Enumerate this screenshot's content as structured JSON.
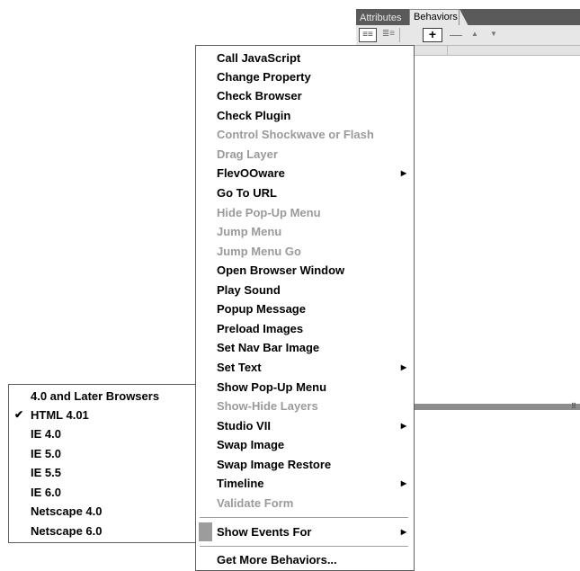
{
  "panel": {
    "tabs": [
      {
        "label": "Attributes"
      },
      {
        "label": "Behaviors"
      }
    ],
    "toolbar": {
      "show_set_icon": "≡≡",
      "show_all_icon": "≣≡",
      "add_icon": "+",
      "remove_icon": "—",
      "up_icon": "▲",
      "down_icon": "▼"
    },
    "grip_icon": "⠿"
  },
  "menu": {
    "items": [
      {
        "label": "Call JavaScript",
        "enabled": true
      },
      {
        "label": "Change Property",
        "enabled": true
      },
      {
        "label": "Check Browser",
        "enabled": true
      },
      {
        "label": "Check Plugin",
        "enabled": true
      },
      {
        "label": "Control Shockwave or Flash",
        "enabled": false
      },
      {
        "label": "Drag Layer",
        "enabled": false
      },
      {
        "label": "FlevOOware",
        "enabled": true,
        "submenu": true
      },
      {
        "label": "Go To URL",
        "enabled": true
      },
      {
        "label": "Hide Pop-Up Menu",
        "enabled": false
      },
      {
        "label": "Jump Menu",
        "enabled": false
      },
      {
        "label": "Jump Menu Go",
        "enabled": false
      },
      {
        "label": "Open Browser Window",
        "enabled": true
      },
      {
        "label": "Play Sound",
        "enabled": true
      },
      {
        "label": "Popup Message",
        "enabled": true
      },
      {
        "label": "Preload Images",
        "enabled": true
      },
      {
        "label": "Set Nav Bar Image",
        "enabled": true
      },
      {
        "label": "Set Text",
        "enabled": true,
        "submenu": true
      },
      {
        "label": "Show Pop-Up Menu",
        "enabled": true
      },
      {
        "label": "Show-Hide Layers",
        "enabled": false
      },
      {
        "label": "Studio VII",
        "enabled": true,
        "submenu": true
      },
      {
        "label": "Swap Image",
        "enabled": true
      },
      {
        "label": "Swap Image Restore",
        "enabled": true
      },
      {
        "label": "Timeline",
        "enabled": true,
        "submenu": true
      },
      {
        "label": "Validate Form",
        "enabled": false
      }
    ],
    "show_events_for": {
      "label": "Show Events For",
      "submenu": true
    },
    "get_more": {
      "label": "Get More Behaviors..."
    },
    "arrow_icon": "▶"
  },
  "events_submenu": {
    "items": [
      {
        "label": "4.0 and Later Browsers",
        "checked": false
      },
      {
        "label": "HTML 4.01",
        "checked": true
      },
      {
        "label": "IE 4.0",
        "checked": false
      },
      {
        "label": "IE 5.0",
        "checked": false
      },
      {
        "label": "IE 5.5",
        "checked": false
      },
      {
        "label": "IE 6.0",
        "checked": false
      },
      {
        "label": "Netscape 4.0",
        "checked": false
      },
      {
        "label": "Netscape 6.0",
        "checked": false
      }
    ],
    "check_icon": "✔"
  }
}
